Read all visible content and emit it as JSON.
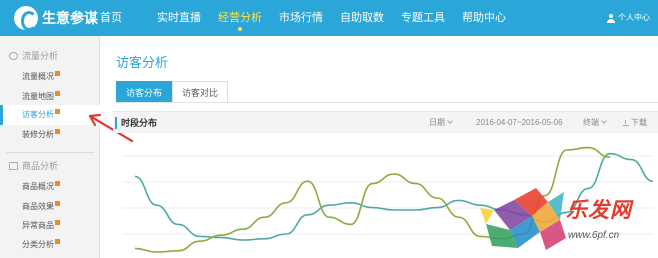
{
  "app": {
    "logo_text": "生意参谋"
  },
  "nav": {
    "items": [
      {
        "label": "首页"
      },
      {
        "label": "实时直播"
      },
      {
        "label": "经营分析"
      },
      {
        "label": "市场行情"
      },
      {
        "label": "自助取数"
      },
      {
        "label": "专题工具"
      },
      {
        "label": "帮助中心"
      }
    ],
    "active": "经营分析",
    "user_label": "个人中心"
  },
  "sidebar": {
    "groups": [
      {
        "label": "流量分析",
        "icon": "eye-icon",
        "items": [
          {
            "label": "流量概况",
            "badge": true
          },
          {
            "label": "流量地图",
            "badge": true
          },
          {
            "label": "访客分析",
            "badge": true,
            "active": true
          },
          {
            "label": "装修分析",
            "badge": true
          }
        ]
      },
      {
        "label": "商品分析",
        "icon": "box-icon",
        "items": [
          {
            "label": "商品概况",
            "badge": true
          },
          {
            "label": "商品效果",
            "badge": true
          },
          {
            "label": "异常商品",
            "badge": true
          },
          {
            "label": "分类分析",
            "badge": true
          }
        ]
      }
    ]
  },
  "main": {
    "title": "访客分析",
    "tabs": [
      {
        "label": "访客分布",
        "active": true
      },
      {
        "label": "访客对比",
        "active": false
      }
    ],
    "panel": {
      "title": "时段分布",
      "date_label": "日期",
      "date_range": "2016-04-07~2016-05-06",
      "device_label": "终端",
      "download_label": "下载"
    }
  },
  "chart_data": {
    "type": "line",
    "series": [
      {
        "color": "#4fa9a3",
        "values": [
          0.68,
          0.44,
          0.28,
          0.18,
          0.17,
          0.15,
          0.16,
          0.2,
          0.36,
          0.44,
          0.46,
          0.42,
          0.4,
          0.4,
          0.42,
          0.48,
          0.44,
          0.4,
          0.36,
          0.3,
          0.38,
          0.58,
          0.87,
          0.82,
          0.64
        ]
      },
      {
        "color": "#8bab3f",
        "values": [
          0.08,
          0.05,
          0.06,
          0.14,
          0.19,
          0.24,
          0.34,
          0.46,
          0.64,
          0.34,
          0.28,
          0.62,
          0.7,
          0.62,
          0.5,
          0.34,
          0.18,
          0.16,
          0.2,
          0.52,
          0.9,
          0.92,
          0.84
        ]
      }
    ],
    "grid": true,
    "gridline_count": 5
  },
  "watermark": {
    "text": "乐发网",
    "url": "www.6pf.cn"
  },
  "annotation": {
    "arrow_color": "#e03a30"
  }
}
